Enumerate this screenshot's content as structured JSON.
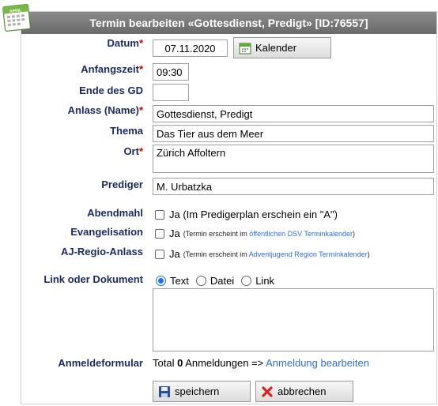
{
  "title": "Termin bearbeiten «Gottesdienst, Predigt» [ID:76557]",
  "calendar_icon_text": "APRIL",
  "required_marker": "*",
  "fields": {
    "datum": {
      "label": "Datum",
      "value": "07.11.2020",
      "button": "Kalender"
    },
    "anfangszeit": {
      "label": "Anfangszeit",
      "value": "09:30"
    },
    "ende": {
      "label": "Ende des GD",
      "value": ""
    },
    "anlass": {
      "label": "Anlass (Name)",
      "value": "Gottesdienst, Predigt"
    },
    "thema": {
      "label": "Thema",
      "value": "Das Tier aus dem Meer"
    },
    "ort": {
      "label": "Ort",
      "value": "Zürich Affoltern"
    },
    "prediger": {
      "label": "Prediger",
      "value": "M. Urbatzka"
    }
  },
  "abendmahl": {
    "label": "Abendmahl",
    "checkbox_label": "Ja (Im Predigerplan erschein ein \"A\")"
  },
  "evangelisation": {
    "label": "Evangelisation",
    "checkbox_label": "Ja",
    "note": "(Termin erscheint im ",
    "link": "öffentlichen DSV Terminkalender",
    "note_end": ")"
  },
  "aj_regio": {
    "label": "AJ-Regio-Anlass",
    "checkbox_label": "Ja",
    "note": "(Termin erscheint im ",
    "link": "Adventjugend Region Terminkalender",
    "note_end": ")"
  },
  "link_dokument": {
    "label": "Link oder Dokument",
    "options": [
      "Text",
      "Datei",
      "Link"
    ],
    "selected": "Text",
    "value": ""
  },
  "anmeldeformular": {
    "label": "Anmeldeformular",
    "prefix": "Total ",
    "count": "0",
    "suffix": " Anmeldungen => ",
    "link": "Anmeldung bearbeiten"
  },
  "buttons": {
    "save": "speichern",
    "cancel": "abbrechen"
  },
  "colors": {
    "title_bg": "#7a7a7a",
    "label": "#1a2a5c",
    "required": "#cc0000",
    "link": "#2f6fd1",
    "radio_accent": "#1a73e8"
  }
}
